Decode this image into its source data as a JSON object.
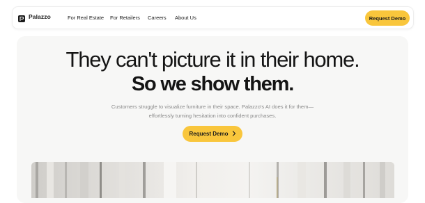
{
  "brand": {
    "name": "Palazzo",
    "logo_icon": "palazzo-logo-icon"
  },
  "nav": {
    "links": [
      {
        "label": "For Real Estate"
      },
      {
        "label": "For Retailers"
      },
      {
        "label": "Careers"
      },
      {
        "label": "About Us"
      }
    ],
    "cta_label": "Request Demo"
  },
  "hero": {
    "headline_line1": "They can't picture it in their home.",
    "headline_line2": "So we show them.",
    "subtext_line1": "Customers struggle to visualize furniture in their space. Palazzo's AI does it for them—",
    "subtext_line2": "effortlessly turning hesitation into confident purchases.",
    "cta_label": "Request Demo",
    "cta_icon": "chevron-right-icon"
  },
  "colors": {
    "accent": "#f9c63c",
    "text": "#141414",
    "muted": "#8a8a8a",
    "hero_bg": "#f7f7f6"
  }
}
